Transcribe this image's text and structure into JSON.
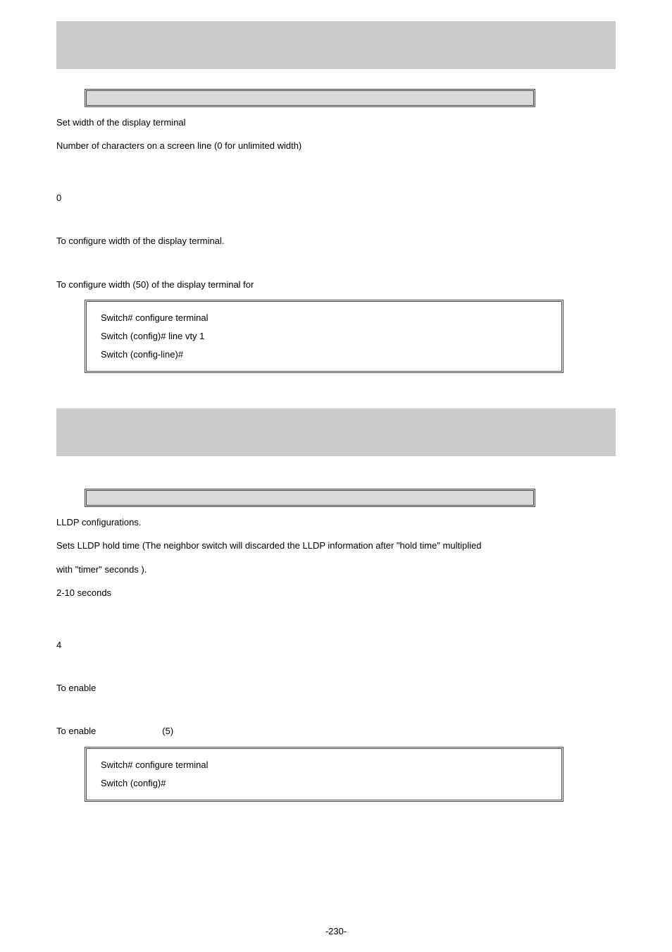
{
  "sections": [
    {
      "banner": "",
      "syntax_box": "",
      "params": [
        {
          "indent": "indent-1",
          "text": "Set width of the display terminal"
        },
        {
          "indent": "indent-2",
          "text": "Number of characters on a screen line (0 for unlimited width)"
        }
      ],
      "default_value": "0",
      "usage": "To configure width of the display terminal.",
      "example_intro": "To configure width (50) of the display terminal for",
      "code": [
        "Switch# configure terminal",
        "Switch (config)# line vty 1",
        "Switch (config-line)#"
      ]
    },
    {
      "banner": "",
      "syntax_box": "",
      "params": [
        {
          "indent": "indent-1",
          "text": "LLDP configurations."
        },
        {
          "indent": "indent-1",
          "text": "Sets LLDP hold time (The neighbor switch will   discarded the LLDP information after \"hold time\" multiplied"
        },
        {
          "indent": "indent-1",
          "text": "with \"timer\" seconds )."
        },
        {
          "indent": "indent-3",
          "text": "2-10  seconds"
        }
      ],
      "default_value": "4",
      "usage": "To enable",
      "example_intro": "To enable                          (5)",
      "code": [
        "Switch# configure terminal",
        "Switch (config)#"
      ]
    }
  ],
  "page_number": "-230-"
}
